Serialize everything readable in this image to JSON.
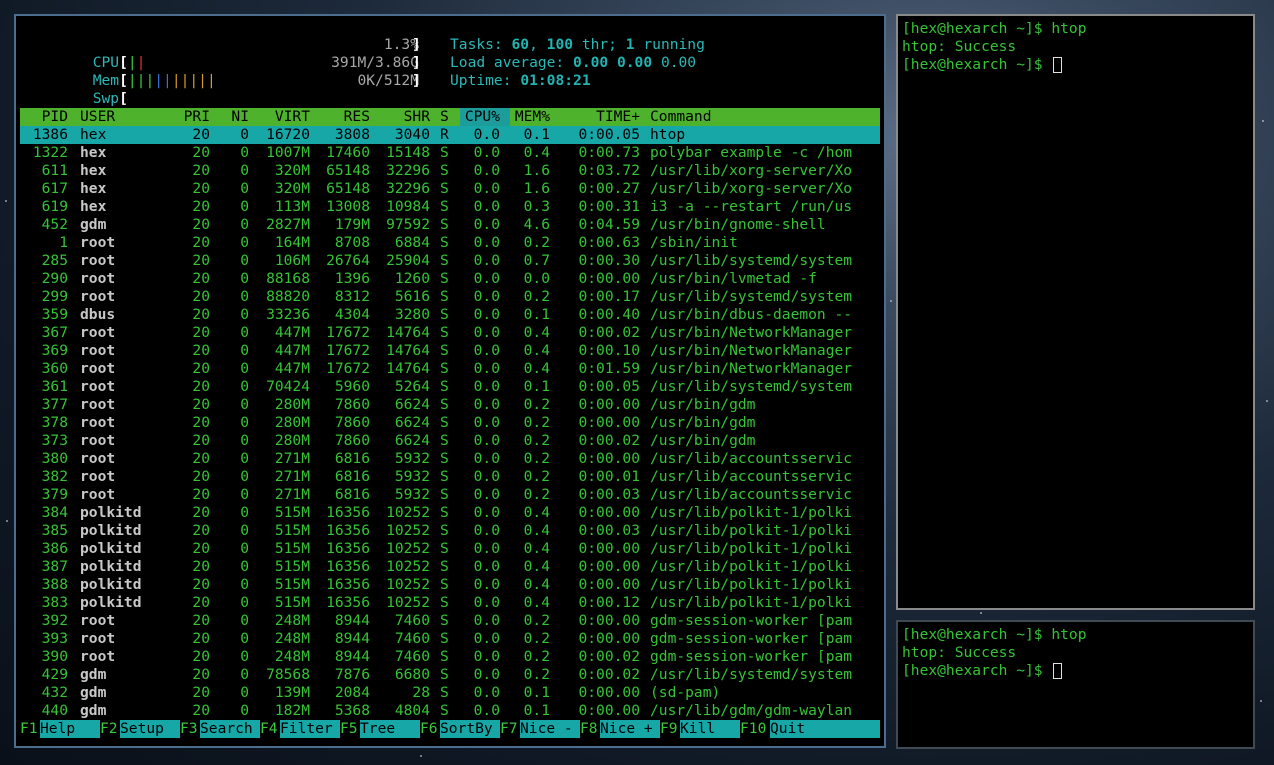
{
  "htop": {
    "meters": {
      "cpu_label": "CPU",
      "cpu_value": "1.3%",
      "mem_label": "Mem",
      "mem_value": "391M/3.86G",
      "swp_label": "Swp",
      "swp_value": "0K/512M",
      "tasks_label": "Tasks:",
      "tasks_count": "60",
      "threads_count": "100",
      "thr_label": "thr;",
      "running_count": "1",
      "running_label": "running",
      "load_label": "Load average:",
      "load1": "0.00",
      "load5": "0.00",
      "load15": "0.00",
      "uptime_label": "Uptime:",
      "uptime_value": "01:08:21"
    },
    "columns": [
      "PID",
      "USER",
      "PRI",
      "NI",
      "VIRT",
      "RES",
      "SHR",
      "S",
      "CPU%",
      "MEM%",
      "TIME+",
      "Command"
    ],
    "sorted_column": "CPU%",
    "selected_row": 0,
    "processes": [
      [
        "1386",
        "hex",
        "20",
        "0",
        "16720",
        "3808",
        "3040",
        "R",
        "0.0",
        "0.1",
        "0:00.05",
        "htop"
      ],
      [
        "1322",
        "hex",
        "20",
        "0",
        "1007M",
        "17460",
        "15148",
        "S",
        "0.0",
        "0.4",
        "0:00.73",
        "polybar example -c /hom"
      ],
      [
        "611",
        "hex",
        "20",
        "0",
        "320M",
        "65148",
        "32296",
        "S",
        "0.0",
        "1.6",
        "0:03.72",
        "/usr/lib/xorg-server/Xo"
      ],
      [
        "617",
        "hex",
        "20",
        "0",
        "320M",
        "65148",
        "32296",
        "S",
        "0.0",
        "1.6",
        "0:00.27",
        "/usr/lib/xorg-server/Xo"
      ],
      [
        "619",
        "hex",
        "20",
        "0",
        "113M",
        "13008",
        "10984",
        "S",
        "0.0",
        "0.3",
        "0:00.31",
        "i3 -a --restart /run/us"
      ],
      [
        "452",
        "gdm",
        "20",
        "0",
        "2827M",
        "179M",
        "97592",
        "S",
        "0.0",
        "4.6",
        "0:04.59",
        "/usr/bin/gnome-shell"
      ],
      [
        "1",
        "root",
        "20",
        "0",
        "164M",
        "8708",
        "6884",
        "S",
        "0.0",
        "0.2",
        "0:00.63",
        "/sbin/init"
      ],
      [
        "285",
        "root",
        "20",
        "0",
        "106M",
        "26764",
        "25904",
        "S",
        "0.0",
        "0.7",
        "0:00.30",
        "/usr/lib/systemd/system"
      ],
      [
        "290",
        "root",
        "20",
        "0",
        "88168",
        "1396",
        "1260",
        "S",
        "0.0",
        "0.0",
        "0:00.00",
        "/usr/bin/lvmetad -f"
      ],
      [
        "299",
        "root",
        "20",
        "0",
        "88820",
        "8312",
        "5616",
        "S",
        "0.0",
        "0.2",
        "0:00.17",
        "/usr/lib/systemd/system"
      ],
      [
        "359",
        "dbus",
        "20",
        "0",
        "33236",
        "4304",
        "3280",
        "S",
        "0.0",
        "0.1",
        "0:00.40",
        "/usr/bin/dbus-daemon --"
      ],
      [
        "367",
        "root",
        "20",
        "0",
        "447M",
        "17672",
        "14764",
        "S",
        "0.0",
        "0.4",
        "0:00.02",
        "/usr/bin/NetworkManager"
      ],
      [
        "369",
        "root",
        "20",
        "0",
        "447M",
        "17672",
        "14764",
        "S",
        "0.0",
        "0.4",
        "0:00.10",
        "/usr/bin/NetworkManager"
      ],
      [
        "360",
        "root",
        "20",
        "0",
        "447M",
        "17672",
        "14764",
        "S",
        "0.0",
        "0.4",
        "0:01.59",
        "/usr/bin/NetworkManager"
      ],
      [
        "361",
        "root",
        "20",
        "0",
        "70424",
        "5960",
        "5264",
        "S",
        "0.0",
        "0.1",
        "0:00.05",
        "/usr/lib/systemd/system"
      ],
      [
        "377",
        "root",
        "20",
        "0",
        "280M",
        "7860",
        "6624",
        "S",
        "0.0",
        "0.2",
        "0:00.00",
        "/usr/bin/gdm"
      ],
      [
        "378",
        "root",
        "20",
        "0",
        "280M",
        "7860",
        "6624",
        "S",
        "0.0",
        "0.2",
        "0:00.00",
        "/usr/bin/gdm"
      ],
      [
        "373",
        "root",
        "20",
        "0",
        "280M",
        "7860",
        "6624",
        "S",
        "0.0",
        "0.2",
        "0:00.02",
        "/usr/bin/gdm"
      ],
      [
        "380",
        "root",
        "20",
        "0",
        "271M",
        "6816",
        "5932",
        "S",
        "0.0",
        "0.2",
        "0:00.00",
        "/usr/lib/accountsservic"
      ],
      [
        "382",
        "root",
        "20",
        "0",
        "271M",
        "6816",
        "5932",
        "S",
        "0.0",
        "0.2",
        "0:00.01",
        "/usr/lib/accountsservic"
      ],
      [
        "379",
        "root",
        "20",
        "0",
        "271M",
        "6816",
        "5932",
        "S",
        "0.0",
        "0.2",
        "0:00.03",
        "/usr/lib/accountsservic"
      ],
      [
        "384",
        "polkitd",
        "20",
        "0",
        "515M",
        "16356",
        "10252",
        "S",
        "0.0",
        "0.4",
        "0:00.00",
        "/usr/lib/polkit-1/polki"
      ],
      [
        "385",
        "polkitd",
        "20",
        "0",
        "515M",
        "16356",
        "10252",
        "S",
        "0.0",
        "0.4",
        "0:00.03",
        "/usr/lib/polkit-1/polki"
      ],
      [
        "386",
        "polkitd",
        "20",
        "0",
        "515M",
        "16356",
        "10252",
        "S",
        "0.0",
        "0.4",
        "0:00.00",
        "/usr/lib/polkit-1/polki"
      ],
      [
        "387",
        "polkitd",
        "20",
        "0",
        "515M",
        "16356",
        "10252",
        "S",
        "0.0",
        "0.4",
        "0:00.00",
        "/usr/lib/polkit-1/polki"
      ],
      [
        "388",
        "polkitd",
        "20",
        "0",
        "515M",
        "16356",
        "10252",
        "S",
        "0.0",
        "0.4",
        "0:00.00",
        "/usr/lib/polkit-1/polki"
      ],
      [
        "383",
        "polkitd",
        "20",
        "0",
        "515M",
        "16356",
        "10252",
        "S",
        "0.0",
        "0.4",
        "0:00.12",
        "/usr/lib/polkit-1/polki"
      ],
      [
        "392",
        "root",
        "20",
        "0",
        "248M",
        "8944",
        "7460",
        "S",
        "0.0",
        "0.2",
        "0:00.00",
        "gdm-session-worker [pam"
      ],
      [
        "393",
        "root",
        "20",
        "0",
        "248M",
        "8944",
        "7460",
        "S",
        "0.0",
        "0.2",
        "0:00.00",
        "gdm-session-worker [pam"
      ],
      [
        "390",
        "root",
        "20",
        "0",
        "248M",
        "8944",
        "7460",
        "S",
        "0.0",
        "0.2",
        "0:00.02",
        "gdm-session-worker [pam"
      ],
      [
        "429",
        "gdm",
        "20",
        "0",
        "78568",
        "7876",
        "6680",
        "S",
        "0.0",
        "0.2",
        "0:00.02",
        "/usr/lib/systemd/system"
      ],
      [
        "432",
        "gdm",
        "20",
        "0",
        "139M",
        "2084",
        "28",
        "S",
        "0.0",
        "0.1",
        "0:00.00",
        "(sd-pam)"
      ],
      [
        "440",
        "gdm",
        "20",
        "0",
        "182M",
        "5368",
        "4804",
        "S",
        "0.0",
        "0.1",
        "0:00.00",
        "/usr/lib/gdm/gdm-waylan"
      ]
    ],
    "function_keys": [
      {
        "key": "F1",
        "label": "Help  "
      },
      {
        "key": "F2",
        "label": "Setup "
      },
      {
        "key": "F3",
        "label": "Search"
      },
      {
        "key": "F4",
        "label": "Filter"
      },
      {
        "key": "F5",
        "label": "Tree  "
      },
      {
        "key": "F6",
        "label": "SortBy"
      },
      {
        "key": "F7",
        "label": "Nice -"
      },
      {
        "key": "F8",
        "label": "Nice +"
      },
      {
        "key": "F9",
        "label": "Kill  "
      },
      {
        "key": "F10",
        "label": "Quit"
      }
    ]
  },
  "terminal_top": {
    "lines": [
      "[hex@hexarch ~]$ htop",
      "htop: Success",
      "[hex@hexarch ~]$ "
    ]
  },
  "terminal_bottom": {
    "lines": [
      "[hex@hexarch ~]$ htop",
      "htop: Success",
      "[hex@hexarch ~]$ "
    ]
  },
  "colors": {
    "header_bar": "#4fb22d",
    "selection": "#18a7a7",
    "text_green": "#36c336",
    "label_cyan": "#22b3b3"
  }
}
